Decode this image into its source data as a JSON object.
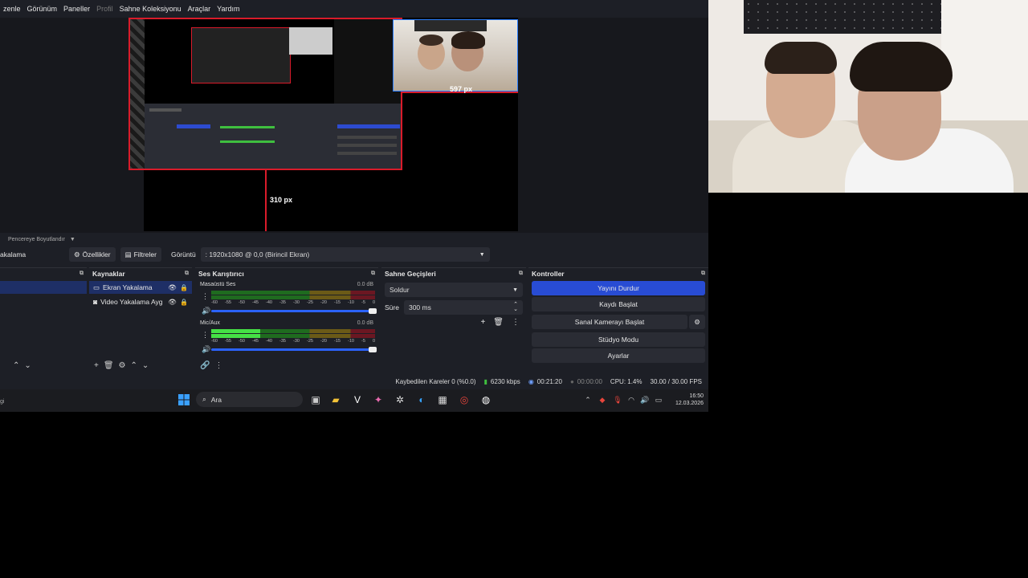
{
  "menubar": {
    "items": [
      "zenle",
      "Görünüm",
      "Paneller",
      "Profil",
      "Sahne Koleksiyonu",
      "Araçlar",
      "Yardım"
    ]
  },
  "preview": {
    "width_label": "597 px",
    "height_label": "310 px"
  },
  "resize": {
    "label": "Pencereye Boyutlandır"
  },
  "toolbar": {
    "left_label": "akalama",
    "properties": "Özellikler",
    "filters": "Filtreler",
    "display_label": "Görüntü",
    "display_value": ": 1920x1080 @ 0,0 (Birincil Ekran)"
  },
  "docks": {
    "sources": {
      "title": "Kaynaklar",
      "items": [
        {
          "label": "Ekran Yakalama",
          "icon": "monitor-icon",
          "selected": true
        },
        {
          "label": "Video Yakalama Ayg",
          "icon": "camera-icon",
          "selected": false
        }
      ]
    },
    "mixer": {
      "title": "Ses Karıştırıcı",
      "ticks": [
        "-60",
        "-55",
        "-50",
        "-45",
        "-40",
        "-35",
        "-30",
        "-25",
        "-20",
        "-15",
        "-10",
        "-5",
        "0"
      ],
      "channels": [
        {
          "name": "Masaüstü Ses",
          "db": "0.0 dB",
          "level": 0.0
        },
        {
          "name": "Mic/Aux",
          "db": "0.0 dB",
          "level": 0.3
        }
      ]
    },
    "transitions": {
      "title": "Sahne Geçişleri",
      "type": "Soldur",
      "duration_label": "Süre",
      "duration_value": "300 ms"
    },
    "controls": {
      "title": "Kontroller",
      "stop_stream": "Yayını Durdur",
      "start_record": "Kaydı Başlat",
      "virtual_cam": "Sanal Kamerayı Başlat",
      "studio_mode": "Stüdyo Modu",
      "settings": "Ayarlar"
    }
  },
  "status": {
    "dropped": "Kaybedilen Kareler 0 (%0.0)",
    "bitrate": "6230 kbps",
    "stream_time": "00:21:20",
    "record_time": "00:00:00",
    "cpu": "CPU: 1.4%",
    "fps": "30.00 / 30.00 FPS"
  },
  "taskbar": {
    "search_placeholder": "Ara",
    "time": "16:50",
    "date": "12.03.2026",
    "left_text": "gi"
  },
  "colors": {
    "accent": "#284cd4",
    "selection": "#1e2f66",
    "crop_red": "#d91b2a"
  }
}
